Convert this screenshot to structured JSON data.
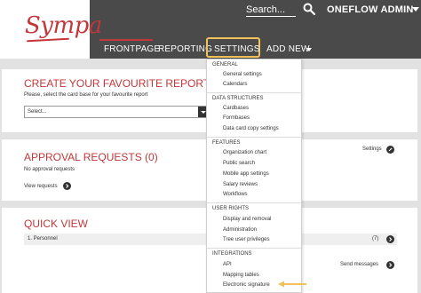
{
  "header": {
    "logo_text": "Sympa",
    "search_placeholder": "Search...",
    "user_name": "ONEFLOW ADMIN",
    "nav": {
      "frontpage": "FRONTPAGE",
      "reporting": "REPORTING",
      "settings": "SETTINGS",
      "add_new": "ADD NEW"
    }
  },
  "report_section": {
    "title": "CREATE YOUR FAVOURITE REPORT HERE",
    "description": "Please, select the card base for your favourite report",
    "select_value": "Select..."
  },
  "approval_section": {
    "title": "APPROVAL REQUESTS (0)",
    "empty_text": "No approval requests",
    "view_link": "View requests",
    "settings_link": "Settings"
  },
  "quick_view": {
    "title": "QUICK VIEW",
    "rows": [
      {
        "label": "1. Personnel",
        "count": "(7)"
      }
    ],
    "send_messages": "Send messages"
  },
  "settings_menu": {
    "groups": [
      {
        "heading": "GENERAL",
        "items": [
          "General settings",
          "Calendars"
        ]
      },
      {
        "heading": "DATA STRUCTURES",
        "items": [
          "Cardbases",
          "Formbases",
          "Data card copy settings"
        ]
      },
      {
        "heading": "FEATURES",
        "items": [
          "Organization chart",
          "Public search",
          "Mobile app settings",
          "Salary reviews",
          "Workflows"
        ]
      },
      {
        "heading": "USER RIGHTS",
        "items": [
          "Display and removal",
          "Administration",
          "Tree user privileges"
        ]
      },
      {
        "heading": "INTEGRATIONS",
        "items": [
          "API",
          "Mapping tables",
          "Electronic signature"
        ]
      }
    ]
  },
  "colors": {
    "brand_red": "#c3373b",
    "header_gray": "#4a4a4a",
    "highlight_yellow": "#f2c15a"
  },
  "icons": {
    "search": "search-icon",
    "arrow_circle": "arrow-circle-icon",
    "pointer_arrow": "arrow-left-icon"
  }
}
